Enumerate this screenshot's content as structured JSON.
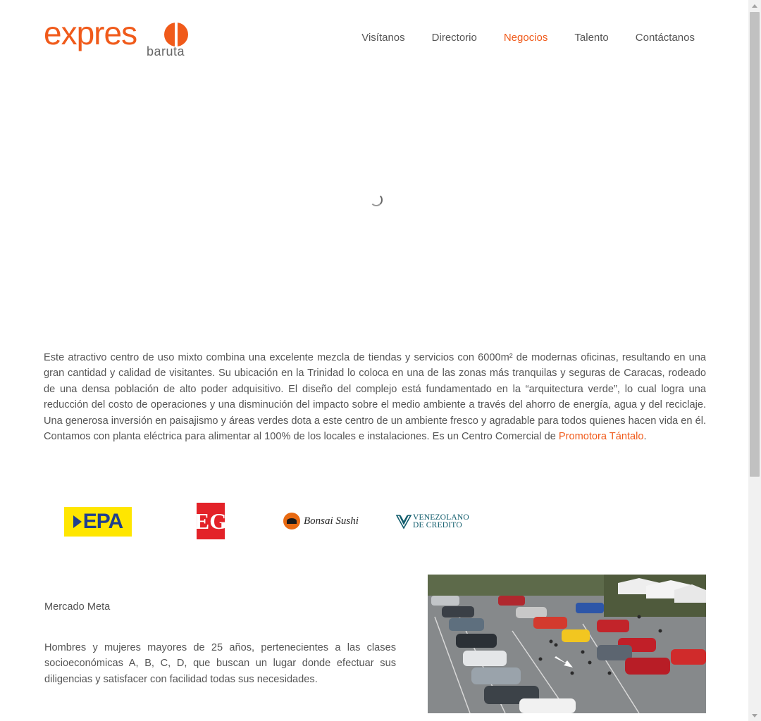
{
  "brand": {
    "name": "expreso",
    "name_prefix": "expres",
    "subtitle": "baruta",
    "accent_color": "#f05a1a"
  },
  "nav": {
    "items": [
      {
        "label": "Visítanos",
        "active": false
      },
      {
        "label": "Directorio",
        "active": false
      },
      {
        "label": "Negocios",
        "active": true
      },
      {
        "label": "Talento",
        "active": false
      },
      {
        "label": "Contáctanos",
        "active": false
      }
    ]
  },
  "intro": {
    "text": "Este atractivo centro de uso mixto combina una excelente mezcla de tiendas y servicios con 6000m² de modernas oficinas, resultando en una gran cantidad y calidad de visitantes. Su ubicación en la Trinidad lo coloca en una de las zonas más tranquilas y seguras de Caracas, rodeado de una densa población de alto poder adquisitivo. El diseño del complejo está fundamentado en la “arquitectura verde”, lo cual logra una reducción del costo de operaciones y una disminución del impacto sobre el medio ambiente a través del ahorro de energía, agua y del reciclaje. Una generosa inversión en paisajismo y áreas verdes dota a este centro de un ambiente fresco y agradable para todos quienes hacen vida en él. Contamos con planta eléctrica para alimentar al 100% de los locales e instalaciones. Es un Centro Comercial de ",
    "link_text": "Promotora Tántalo",
    "suffix": "."
  },
  "brands": {
    "epa": "EPA",
    "eg": "EG",
    "bonsai": "Bonsai Sushi",
    "venezolano_line1": "VENEZOLANO",
    "venezolano_line2": "DE CREDITO"
  },
  "mercado": {
    "title": "Mercado Meta",
    "body": "Hombres y mujeres mayores de 25 años, pertenecientes a las clases socioeconómicas A, B, C, D, que buscan un lugar donde efectuar sus diligencias y satisfacer con facilidad todas sus necesidades."
  }
}
